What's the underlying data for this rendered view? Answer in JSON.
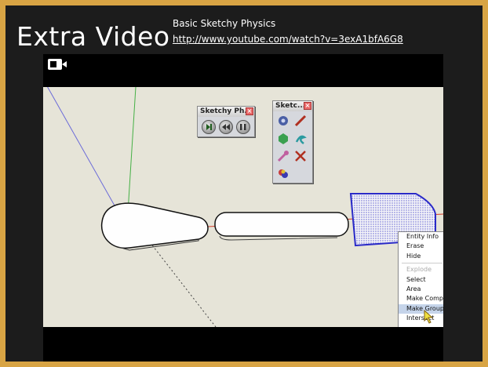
{
  "slide": {
    "title": "Extra Video",
    "video_title": "Basic Sketchy Physics",
    "video_url": "http://www.youtube.com/watch?v=3exA1bfA6G8"
  },
  "toolbars": {
    "sketchy_physics_title": "Sketchy Ph...",
    "sketchy_tools_title": "Sketc..."
  },
  "context_menu": {
    "items": [
      "Entity Info",
      "Erase",
      "Hide",
      "Explode",
      "Select",
      "Area",
      "Make Compone",
      "Make Group",
      "Intersect"
    ]
  },
  "colors": {
    "frame": "#d8a444",
    "background": "#1c1c1c",
    "viewport": "#e6e4d8",
    "selection_blue": "#3030c8"
  }
}
